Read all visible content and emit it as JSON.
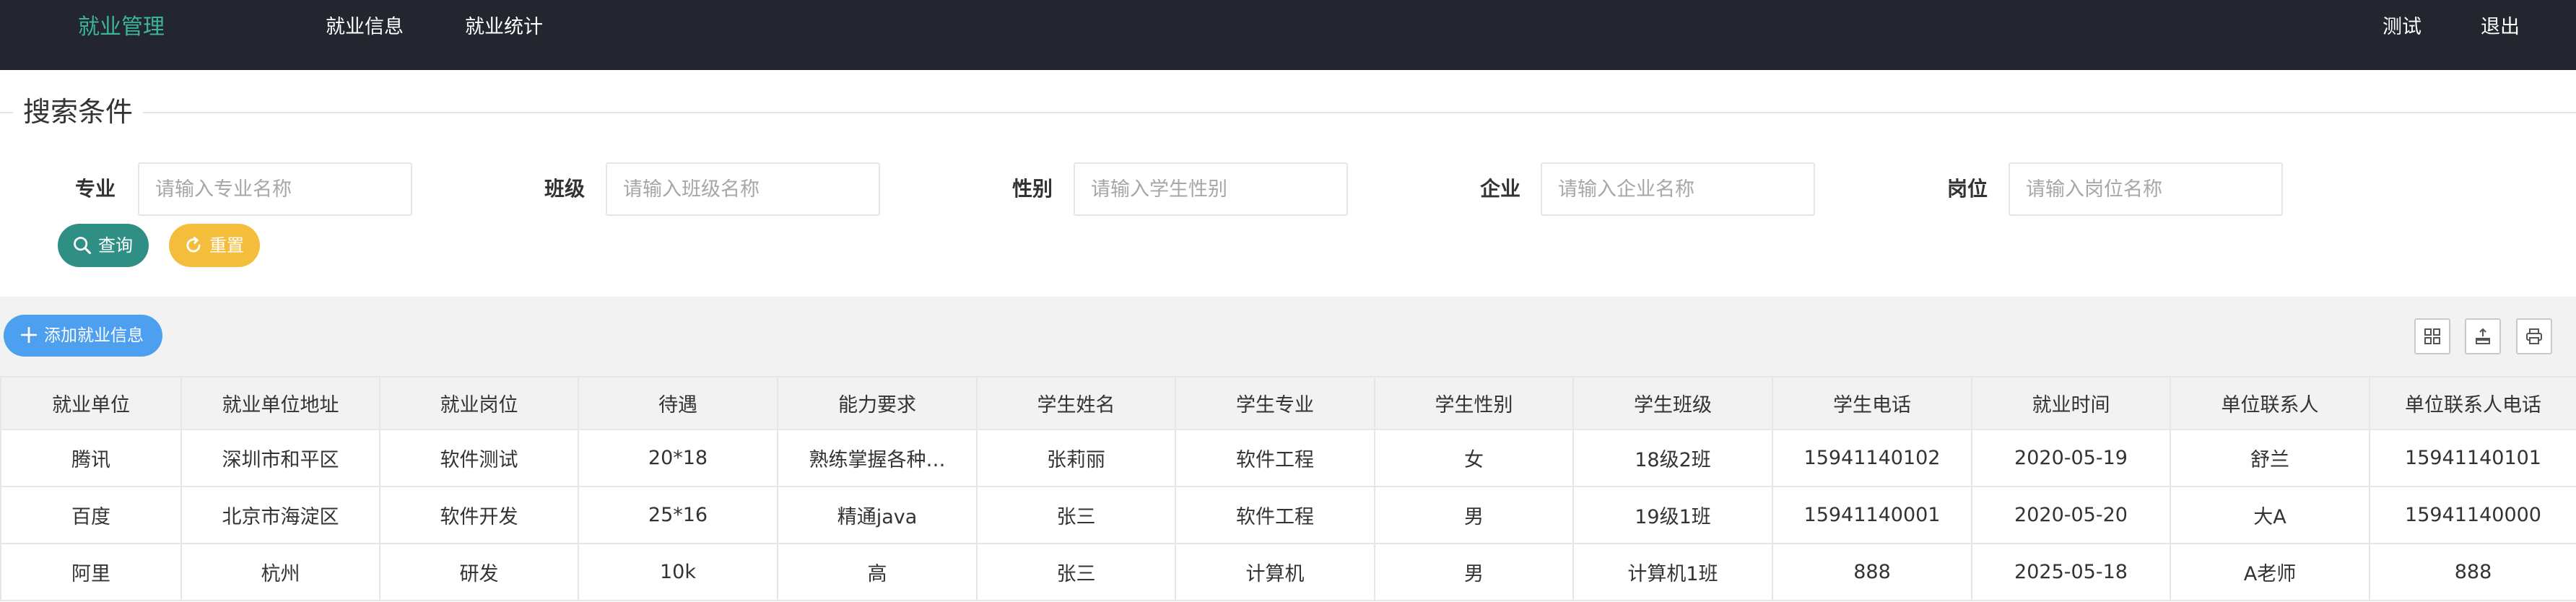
{
  "header": {
    "brand": "就业管理",
    "nav": [
      "就业信息",
      "就业统计"
    ],
    "right": [
      "测试",
      "退出"
    ]
  },
  "search": {
    "legend": "搜索条件",
    "fields": [
      {
        "label": "专业",
        "placeholder": "请输入专业名称"
      },
      {
        "label": "班级",
        "placeholder": "请输入班级名称"
      },
      {
        "label": "性别",
        "placeholder": "请输入学生性别"
      },
      {
        "label": "企业",
        "placeholder": "请输入企业名称"
      },
      {
        "label": "岗位",
        "placeholder": "请输入岗位名称"
      }
    ],
    "query_label": "查询",
    "reset_label": "重置"
  },
  "toolbar": {
    "add_label": "添加就业信息",
    "tools": [
      "columns-icon",
      "export-icon",
      "print-icon"
    ]
  },
  "colors": {
    "header_bg": "#23262e",
    "brand": "#3db39e",
    "query": "#2f8f84",
    "reset": "#f5bd3c",
    "add": "#4d9ff0"
  },
  "table": {
    "columns": [
      "就业单位",
      "就业单位地址",
      "就业岗位",
      "待遇",
      "能力要求",
      "学生姓名",
      "学生专业",
      "学生性别",
      "学生班级",
      "学生电话",
      "就业时间",
      "单位联系人",
      "单位联系人电话"
    ],
    "rows": [
      [
        "腾讯",
        "深圳市和平区",
        "软件测试",
        "20*18",
        "熟练掌握各种…",
        "张莉丽",
        "软件工程",
        "女",
        "18级2班",
        "15941140102",
        "2020-05-19",
        "舒兰",
        "15941140101"
      ],
      [
        "百度",
        "北京市海淀区",
        "软件开发",
        "25*16",
        "精通java",
        "张三",
        "软件工程",
        "男",
        "19级1班",
        "15941140001",
        "2020-05-20",
        "大A",
        "15941140000"
      ],
      [
        "阿里",
        "杭州",
        "研发",
        "10k",
        "高",
        "张三",
        "计算机",
        "男",
        "计算机1班",
        "888",
        "2025-05-18",
        "A老师",
        "888"
      ]
    ]
  }
}
